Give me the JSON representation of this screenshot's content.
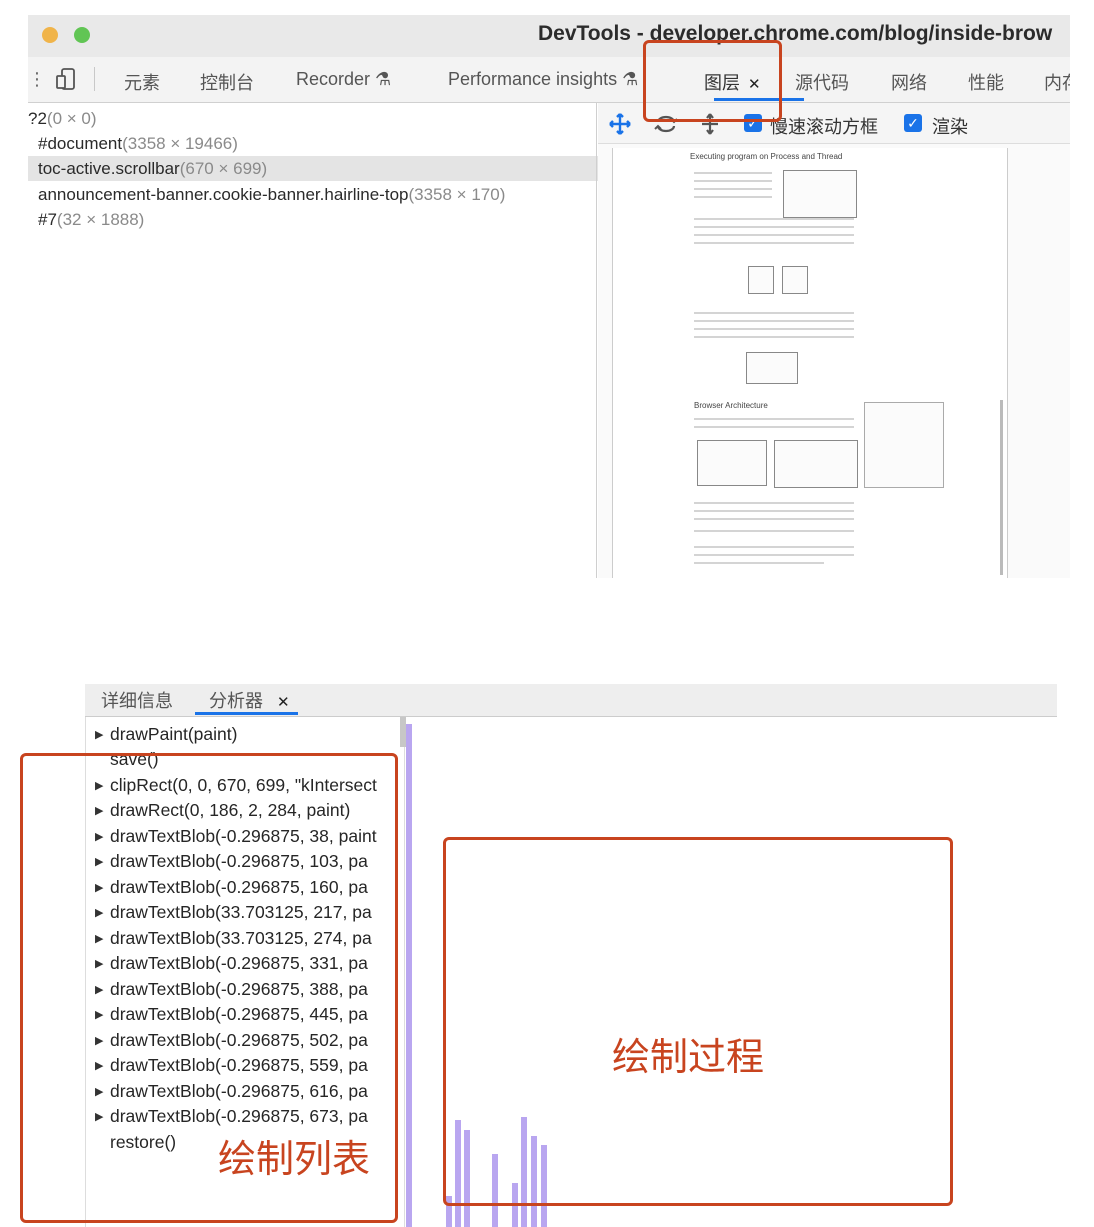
{
  "window": {
    "title": "DevTools - developer.chrome.com/blog/inside-brow"
  },
  "tabs": [
    {
      "label": "元素"
    },
    {
      "label": "控制台"
    },
    {
      "label": "Recorder"
    },
    {
      "label": "Performance insights"
    },
    {
      "label": "图层"
    },
    {
      "label": "源代码"
    },
    {
      "label": "网络"
    },
    {
      "label": "性能"
    },
    {
      "label": "内存"
    }
  ],
  "layers": [
    {
      "name": "?2",
      "dims": "(0 × 0)"
    },
    {
      "name": "#document",
      "dims": "(3358 × 19466)"
    },
    {
      "name": "toc-active.scrollbar",
      "dims": "(670 × 699)"
    },
    {
      "name": "announcement-banner.cookie-banner.hairline-top",
      "dims": "(3358 × 170)"
    },
    {
      "name": "#7",
      "dims": "(32 × 1888)"
    }
  ],
  "layer_toolbar": {
    "slow_scroll_label": "慢速滚动方框",
    "paint_label": "渲染"
  },
  "preview": {
    "heading1": "Executing program on Process and Thread",
    "heading2": "Browser Architecture"
  },
  "profiler": {
    "tabs": [
      {
        "label": "详细信息"
      },
      {
        "label": "分析器"
      }
    ],
    "commands": [
      {
        "text": "drawPaint(paint)",
        "expandable": true
      },
      {
        "text": "save()",
        "expandable": false
      },
      {
        "text": "clipRect(0, 0, 670, 699, \"kIntersect",
        "expandable": true
      },
      {
        "text": "drawRect(0, 186, 2, 284, paint)",
        "expandable": true
      },
      {
        "text": "drawTextBlob(-0.296875, 38, paint",
        "expandable": true
      },
      {
        "text": "drawTextBlob(-0.296875, 103, pa",
        "expandable": true
      },
      {
        "text": "drawTextBlob(-0.296875, 160, pa",
        "expandable": true
      },
      {
        "text": "drawTextBlob(33.703125, 217, pa",
        "expandable": true
      },
      {
        "text": "drawTextBlob(33.703125, 274, pa",
        "expandable": true
      },
      {
        "text": "drawTextBlob(-0.296875, 331, pa",
        "expandable": true
      },
      {
        "text": "drawTextBlob(-0.296875, 388, pa",
        "expandable": true
      },
      {
        "text": "drawTextBlob(-0.296875, 445, pa",
        "expandable": true
      },
      {
        "text": "drawTextBlob(-0.296875, 502, pa",
        "expandable": true
      },
      {
        "text": "drawTextBlob(-0.296875, 559, pa",
        "expandable": true
      },
      {
        "text": "drawTextBlob(-0.296875, 616, pa",
        "expandable": true
      },
      {
        "text": "drawTextBlob(-0.296875, 673, pa",
        "expandable": true
      },
      {
        "text": "restore()",
        "expandable": false
      }
    ]
  },
  "annotations": {
    "paint_list": "绘制列表",
    "paint_process": "绘制过程"
  },
  "colors": {
    "accent": "#1a73e8",
    "annotation": "#c8441f",
    "bar": "#b9a6f0"
  }
}
